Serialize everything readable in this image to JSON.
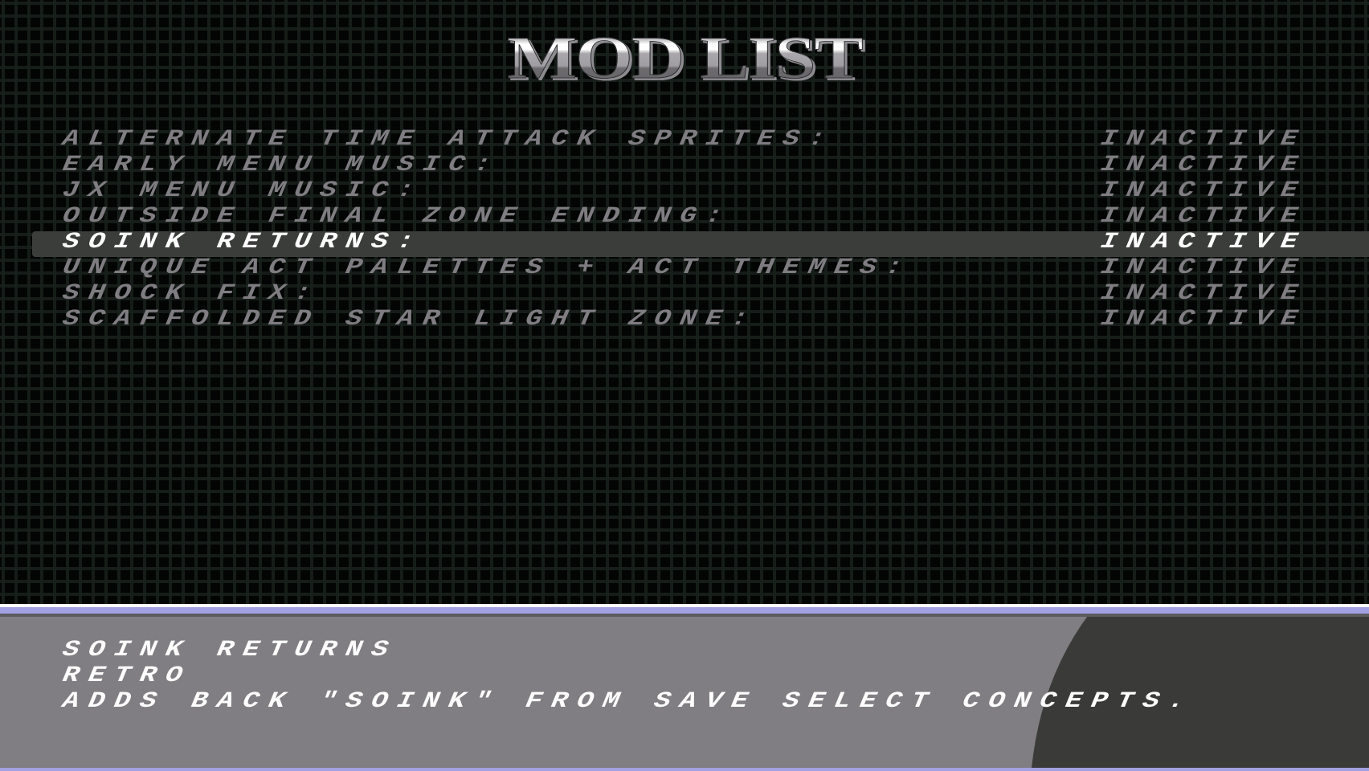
{
  "screen": {
    "title": "MOD LIST"
  },
  "mods": [
    {
      "name": "ALTERNATE TIME ATTACK SPRITES:",
      "status": "INACTIVE",
      "selected": false
    },
    {
      "name": "EARLY MENU MUSIC:",
      "status": "INACTIVE",
      "selected": false
    },
    {
      "name": "JX MENU MUSIC:",
      "status": "INACTIVE",
      "selected": false
    },
    {
      "name": "OUTSIDE FINAL ZONE ENDING:",
      "status": "INACTIVE",
      "selected": false
    },
    {
      "name": "SOINK RETURNS:",
      "status": "INACTIVE",
      "selected": true
    },
    {
      "name": "UNIQUE ACT PALETTES + ACT THEMES:",
      "status": "INACTIVE",
      "selected": false
    },
    {
      "name": "SHOCK FIX:",
      "status": "INACTIVE",
      "selected": false
    },
    {
      "name": "SCAFFOLDED STAR LIGHT ZONE:",
      "status": "INACTIVE",
      "selected": false
    }
  ],
  "details": {
    "name": "SOINK RETURNS",
    "category": "RETRO",
    "description": "ADDS BACK \"SOINK\" FROM SAVE SELECT CONCEPTS."
  },
  "colors": {
    "background": "#030504",
    "text_inactive": "#7f7d81",
    "text_selected": "#ffffff",
    "highlight_bar": "#3b3d3b",
    "panel_accent": "#a3a0e3",
    "panel_bg": "#807e82",
    "panel_dark": "#3a3b39"
  }
}
